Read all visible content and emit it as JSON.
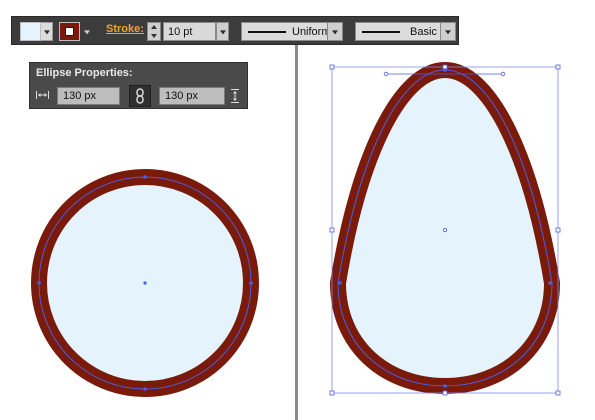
{
  "toolbar": {
    "fill_color": "#e4f3fc",
    "stroke_color": "#7a1a0a",
    "stroke_label": "Stroke:",
    "stroke_weight": "10 pt",
    "variable_width_profile": "Uniform",
    "brush_definition": "Basic"
  },
  "ellipse_panel": {
    "title": "Ellipse Properties:",
    "width": "130 px",
    "height": "130 px",
    "width_icon": "width-arrows-icon",
    "link_icon": "chain-link-icon",
    "height_icon": "height-arrows-icon"
  },
  "colors": {
    "artwork_fill": "#e4f3fc",
    "artwork_stroke": "#7a1a0a",
    "selection": "#4a5ee0",
    "chrome_dark": "#3c3c3c",
    "stroke_label": "#f0a03c"
  }
}
